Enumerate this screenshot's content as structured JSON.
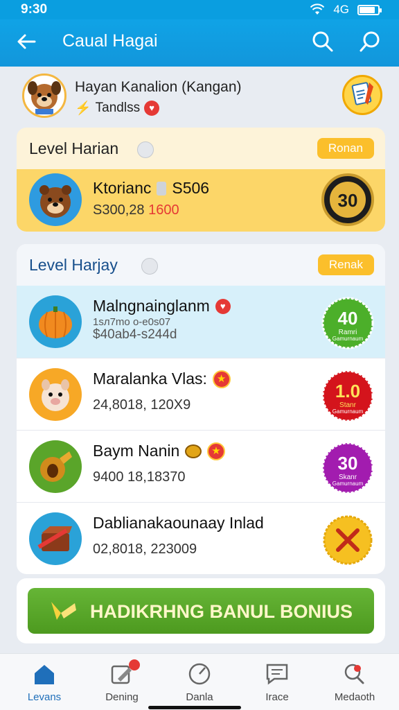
{
  "status": {
    "time": "9:30",
    "indicator": "4G"
  },
  "appbar": {
    "title": "Caual Hagai",
    "icons": [
      "back-arrow-icon",
      "search-icon",
      "search-icon"
    ]
  },
  "profile": {
    "name": "Hayan Kanalion (Kangan)",
    "subtitle": "Tandlss"
  },
  "section1": {
    "label": "Level Harian",
    "pill": "Ronan",
    "row": {
      "title": "Ktorianc",
      "code": "S506",
      "amount": "S300,28",
      "highlight": "1600",
      "seal": "30"
    }
  },
  "section2": {
    "label": "Level Harjay",
    "pill": "Renak",
    "rows": [
      {
        "title": "Malngnainglanm",
        "meta_a": "1sл7mo o-e0s07",
        "meta_b": "$40ab4-s244d",
        "seal_num": "40",
        "seal_word": "Ramri",
        "seal_small": "Gamurnaum",
        "seal_color": "#4caf2a"
      },
      {
        "title": "Maralanka Vlas:",
        "meta": "24,8018, 120X9",
        "seal_num": "1.0",
        "seal_word": "Stanr",
        "seal_small": "Gamurnaum",
        "seal_color": "#d4141c"
      },
      {
        "title": "Baym Nanin",
        "meta": "9400 18,18370",
        "seal_num": "30",
        "seal_word": "Skanr",
        "seal_small": "Gamurnaum",
        "seal_color": "#a21caf"
      },
      {
        "title": "Dablianakaounaay Inlad",
        "meta": "02,8018, 223009",
        "seal_num": "",
        "seal_word": "",
        "seal_small": "",
        "seal_color": "#f6c021"
      }
    ]
  },
  "bonus": {
    "label": "HADIKRHNG BANUL BONIUS"
  },
  "nav": [
    {
      "label": "Levans",
      "icon": "home-icon"
    },
    {
      "label": "Dening",
      "icon": "edit-icon"
    },
    {
      "label": "Danla",
      "icon": "gauge-icon"
    },
    {
      "label": "Irace",
      "icon": "chat-icon"
    },
    {
      "label": "Medaoth",
      "icon": "search-icon"
    }
  ]
}
